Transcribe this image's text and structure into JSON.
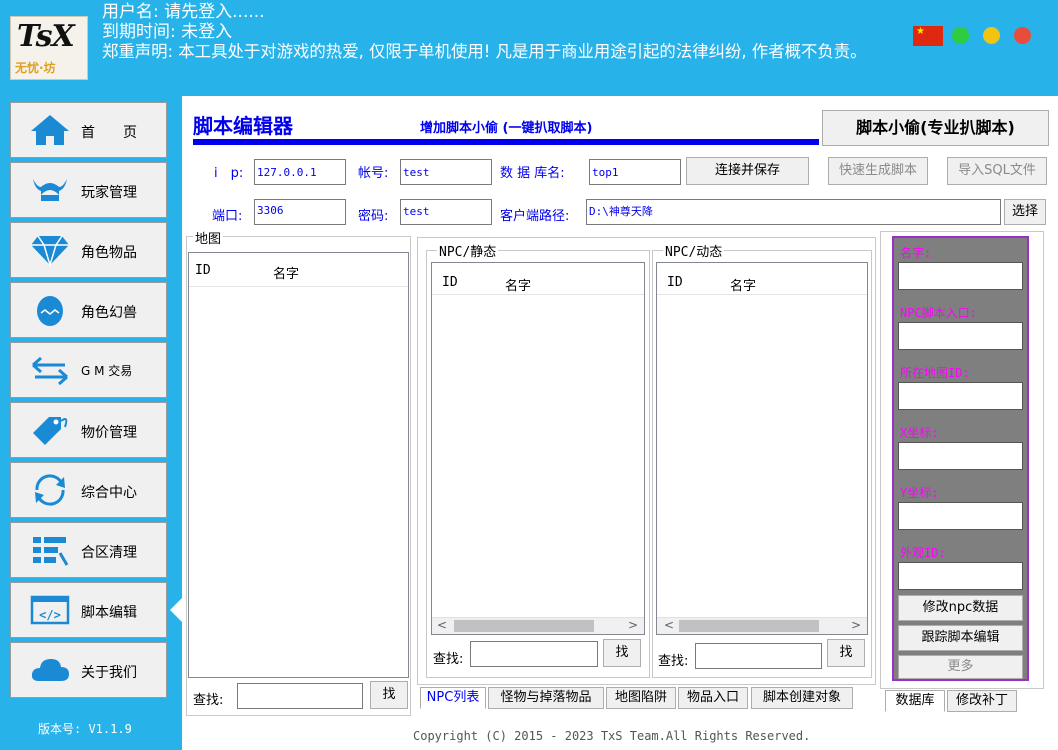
{
  "header": {
    "logo_top": "TsX",
    "logo_bottom": "无忧·坊",
    "username_line": "用户名: 请先登入......",
    "expire_line": "到期时间: 未登入",
    "disclaimer_line": "郑重声明: 本工具处于对游戏的热爱, 仅限于单机使用! 凡是用于商业用途引起的法律纠纷, 作者概不负责。",
    "dot_colors": [
      "#2ecc40",
      "#f1c40f",
      "#e74c3c"
    ]
  },
  "sidebar": {
    "items": [
      {
        "label": "首　　页",
        "icon": "home-icon"
      },
      {
        "label": "玩家管理",
        "icon": "viking-helmet-icon"
      },
      {
        "label": "角色物品",
        "icon": "diamond-icon"
      },
      {
        "label": "角色幻兽",
        "icon": "egg-creature-icon"
      },
      {
        "label": "G M 交易",
        "icon": "exchange-arrows-icon"
      },
      {
        "label": "物价管理",
        "icon": "price-tag-icon"
      },
      {
        "label": "综合中心",
        "icon": "refresh-icon"
      },
      {
        "label": "合区清理",
        "icon": "list-clean-icon"
      },
      {
        "label": "脚本编辑",
        "icon": "code-icon"
      },
      {
        "label": "关于我们",
        "icon": "cloud-icon"
      }
    ],
    "version": "版本号: V1.1.9"
  },
  "main": {
    "title": "脚本编辑器",
    "subtitle": "增加脚本小偷 (一键扒取脚本)",
    "big_button": "脚本小偷(专业扒脚本)",
    "fields": {
      "ip_label": "i　p:",
      "ip_value": "127.0.0.1",
      "account_label": "帐号:",
      "account_value": "test",
      "db_label": "数 据 库名:",
      "db_value": "top1",
      "port_label": "端口:",
      "port_value": "3306",
      "password_label": "密码:",
      "password_value": "test",
      "client_path_label": "客户端路径:",
      "client_path_value": "D:\\神尊天降"
    },
    "buttons": {
      "connect_save": "连接并保存",
      "quick_gen": "快速生成脚本",
      "import_sql": "导入SQL文件",
      "choose": "选择"
    },
    "map_group": {
      "title": "地图",
      "col_id": "ID",
      "col_name": "名字",
      "search_label": "查找:",
      "search_button": "找"
    },
    "npc_static": {
      "title": "NPC/静态",
      "col_id": "ID",
      "col_name": "名字",
      "search_label": "查找:",
      "search_button": "找"
    },
    "npc_dynamic": {
      "title": "NPC/动态",
      "col_id": "ID",
      "col_name": "名字",
      "search_label": "查找:",
      "search_button": "找"
    },
    "tabs": [
      "NPC列表",
      "怪物与掉落物品",
      "地图陷阱",
      "物品入口",
      "脚本创建对象"
    ],
    "right_panel": {
      "labels": [
        "名字:",
        "NPC脚本入口:",
        "所在地图ID:",
        "X坐标:",
        "Y坐标:",
        "外观ID:"
      ],
      "buttons": [
        "修改npc数据",
        "跟踪脚本编辑",
        "更多"
      ]
    },
    "right_tabs": [
      "数据库",
      "修改补丁"
    ],
    "copyright": "Copyright (C) 2015 - 2023 TxS Team.All Rights Reserved."
  }
}
